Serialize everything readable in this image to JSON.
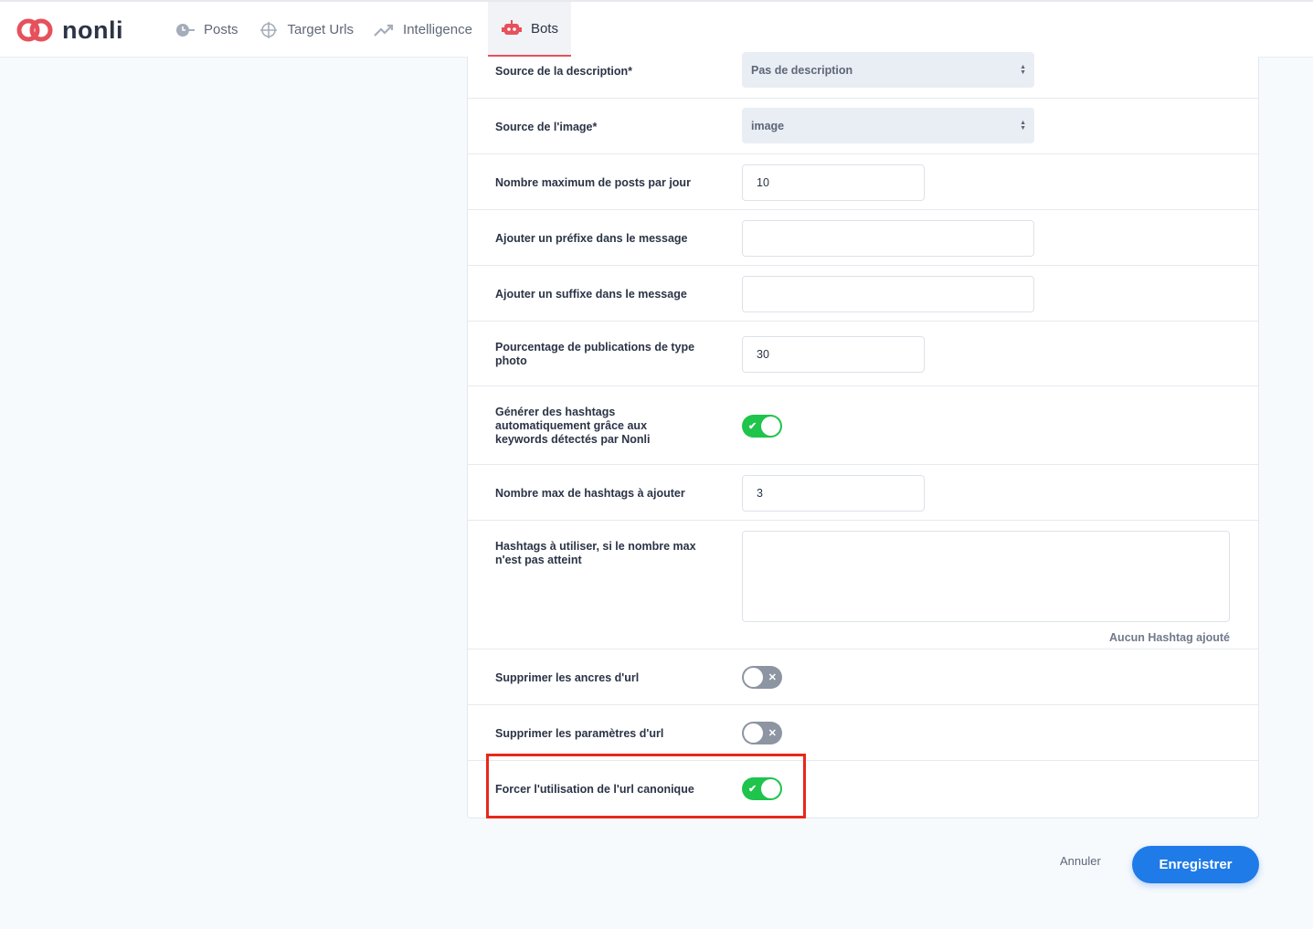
{
  "app": {
    "name": "nonli"
  },
  "nav": {
    "items": [
      {
        "label": "Posts",
        "icon": "clock-icon"
      },
      {
        "label": "Target Urls",
        "icon": "crosshair-icon"
      },
      {
        "label": "Intelligence",
        "icon": "trend-icon"
      },
      {
        "label": "Bots",
        "icon": "robot-icon",
        "active": true
      }
    ]
  },
  "form": {
    "description_source": {
      "label": "Source de la description*",
      "value": "Pas de description"
    },
    "image_source": {
      "label": "Source de l'image*",
      "value": "image"
    },
    "max_posts": {
      "label": "Nombre maximum de posts par jour",
      "value": "10"
    },
    "prefix": {
      "label": "Ajouter un préfixe dans le message",
      "value": ""
    },
    "suffix": {
      "label": "Ajouter un suffixe dans le message",
      "value": ""
    },
    "photo_percent": {
      "label": "Pourcentage de publications de type photo",
      "value": "30"
    },
    "auto_hashtags": {
      "label": "Générer des hashtags automatiquement grâce aux keywords détectés par Nonli",
      "on": true,
      "mark": "✔"
    },
    "max_hashtags": {
      "label": "Nombre max de hashtags à ajouter",
      "value": "3"
    },
    "hashtags": {
      "label": "Hashtags à utiliser, si le nombre max n'est pas atteint",
      "hint": "Aucun Hashtag ajouté"
    },
    "remove_anchors": {
      "label": "Supprimer les ancres d'url",
      "on": false,
      "mark": "✕"
    },
    "remove_params": {
      "label": "Supprimer les paramètres d'url",
      "on": false,
      "mark": "✕"
    },
    "force_canonical": {
      "label": "Forcer l'utilisation de l'url canonique",
      "on": true,
      "mark": "✔"
    }
  },
  "actions": {
    "cancel": "Annuler",
    "save": "Enregistrer"
  },
  "colors": {
    "accent": "#1f7be8",
    "toggle_on": "#1ec44b",
    "toggle_off": "#8d94a2",
    "brand": "#e6515c",
    "highlight": "#e8281a"
  }
}
